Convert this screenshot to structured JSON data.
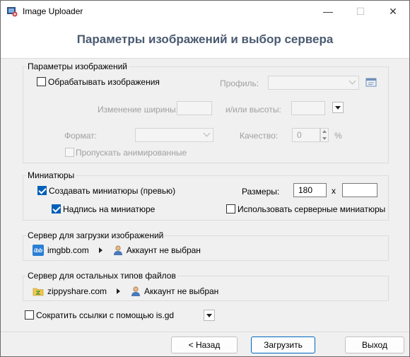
{
  "window": {
    "title": "Image Uploader",
    "minimize_glyph": "—",
    "maximize_glyph": "☐",
    "close_glyph": "✕"
  },
  "header": {
    "title": "Параметры изображений и выбор сервера"
  },
  "image_params": {
    "group_label": "Параметры изображений",
    "process_images_label": "Обрабатывать изображения",
    "profile_label": "Профиль:",
    "resize_width_label": "Изменение ширины:",
    "height_label": "и/или высоты:",
    "format_label": "Формат:",
    "quality_label": "Качество:",
    "quality_value": "0",
    "percent_label": "%",
    "skip_animated_label": "Пропускать анимированные"
  },
  "thumbnails": {
    "group_label": "Миниатюры",
    "create_label": "Создавать миниатюры (превью)",
    "caption_label": "Надпись на миниатюре",
    "sizes_label": "Размеры:",
    "width_value": "180",
    "x_label": "x",
    "height_value": "",
    "server_thumbs_label": "Использовать серверные миниатюры"
  },
  "image_server": {
    "group_label": "Сервер для загрузки изображений",
    "server_icon_text": "ibb",
    "server_name": "imgbb.com",
    "account_label": "Аккаунт не выбран"
  },
  "file_server": {
    "group_label": "Сервер для остальных типов файлов",
    "server_name": "zippyshare.com",
    "account_label": "Аккаунт не выбран"
  },
  "shorten": {
    "label": "Сократить ссылки с помощью is.gd"
  },
  "buttons": {
    "back": "< Назад",
    "upload": "Загрузить",
    "exit": "Выход"
  },
  "colors": {
    "accent": "#005fb8",
    "header_title": "#4a5a70",
    "imgbb_brand": "#2a7fd4"
  }
}
